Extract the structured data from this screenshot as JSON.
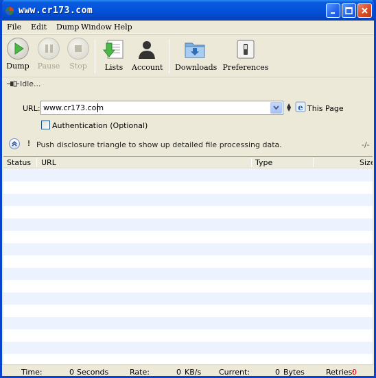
{
  "window": {
    "title": "www.cr173.com"
  },
  "menu": [
    "File",
    "Edit",
    "Dump",
    "Window",
    "Help"
  ],
  "toolbar": {
    "dump": "Dump",
    "pause": "Pause",
    "stop": "Stop",
    "lists": "Lists",
    "account": "Account",
    "downloads": "Downloads",
    "preferences": "Preferences"
  },
  "status": {
    "text": "Idle..."
  },
  "url": {
    "label": "URL:",
    "value": "www.cr173.com",
    "this_page": "This Page"
  },
  "auth": {
    "label": "Authentication (Optional)",
    "checked": false
  },
  "disclosure": {
    "text": "Push disclosure triangle to show up detailed file processing data.",
    "counter": "-/-"
  },
  "table": {
    "columns": [
      "Status",
      "URL",
      "Type",
      "Size"
    ],
    "rows": []
  },
  "bottom": {
    "time_label": "Time:",
    "time_value": "0",
    "time_unit": "Seconds",
    "rate_label": "Rate:",
    "rate_value": "0",
    "rate_unit": "KB/s",
    "current_label": "Current:",
    "current_value": "0",
    "current_unit": "Bytes",
    "retries_label": "Retries:",
    "retries_value": "0"
  },
  "colors": {
    "titlebar": "#0453DB",
    "accent_green": "#4DB84A",
    "row_alt": "#EDF3FE",
    "retries": "#E00000"
  }
}
